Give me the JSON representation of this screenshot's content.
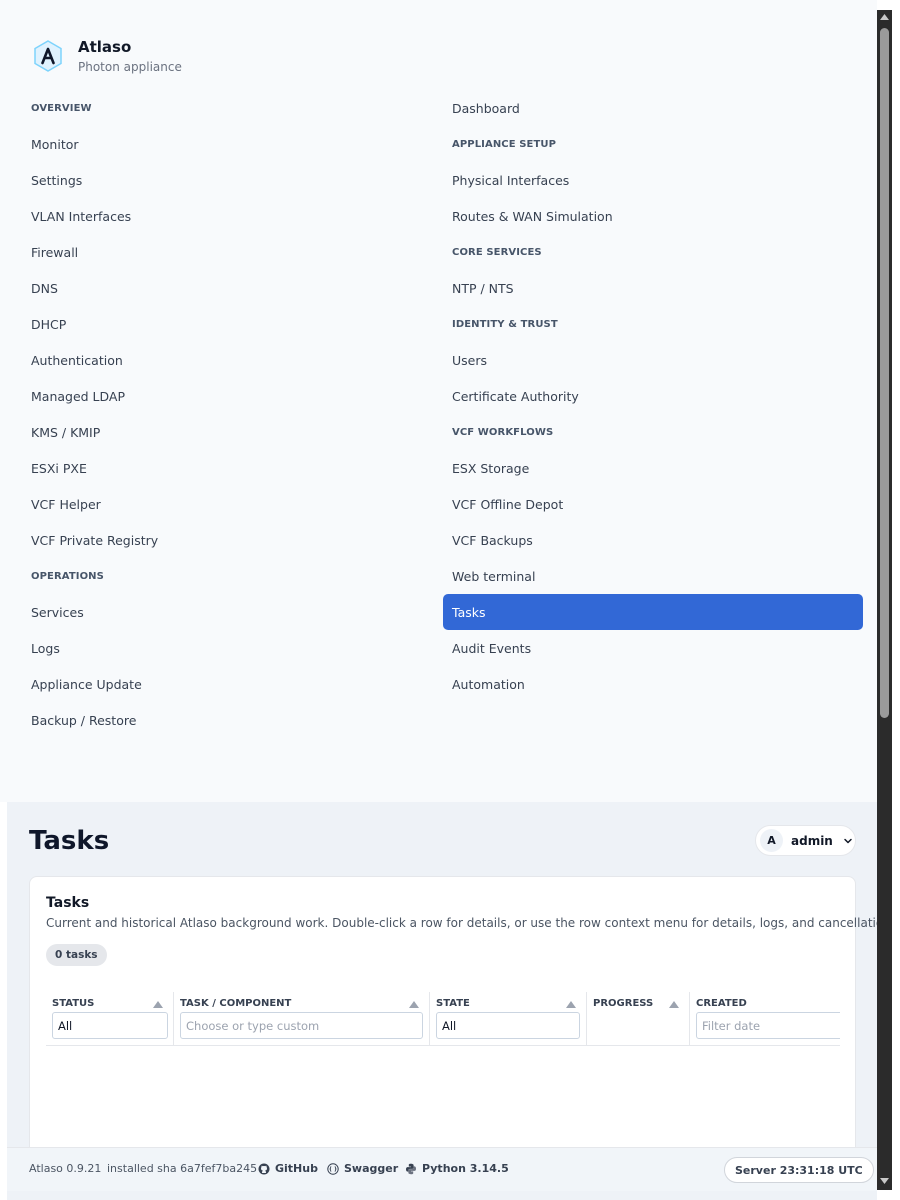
{
  "brand": {
    "name": "Atlaso",
    "subtitle": "Photon appliance"
  },
  "nav": {
    "left": [
      {
        "label": "OVERVIEW",
        "type": "section"
      },
      {
        "label": "Monitor",
        "type": "item"
      },
      {
        "label": "Settings",
        "type": "item"
      },
      {
        "label": "VLAN Interfaces",
        "type": "item"
      },
      {
        "label": "Firewall",
        "type": "item"
      },
      {
        "label": "DNS",
        "type": "item"
      },
      {
        "label": "DHCP",
        "type": "item"
      },
      {
        "label": "Authentication",
        "type": "item"
      },
      {
        "label": "Managed LDAP",
        "type": "item"
      },
      {
        "label": "KMS / KMIP",
        "type": "item"
      },
      {
        "label": "ESXi PXE",
        "type": "item"
      },
      {
        "label": "VCF Helper",
        "type": "item"
      },
      {
        "label": "VCF Private Registry",
        "type": "item"
      },
      {
        "label": "OPERATIONS",
        "type": "section"
      },
      {
        "label": "Services",
        "type": "item"
      },
      {
        "label": "Logs",
        "type": "item"
      },
      {
        "label": "Appliance Update",
        "type": "item"
      },
      {
        "label": "Backup / Restore",
        "type": "item"
      }
    ],
    "right": [
      {
        "label": "Dashboard",
        "type": "item"
      },
      {
        "label": "APPLIANCE SETUP",
        "type": "section"
      },
      {
        "label": "Physical Interfaces",
        "type": "item"
      },
      {
        "label": "Routes & WAN Simulation",
        "type": "item"
      },
      {
        "label": "CORE SERVICES",
        "type": "section"
      },
      {
        "label": "NTP / NTS",
        "type": "item"
      },
      {
        "label": "IDENTITY & TRUST",
        "type": "section"
      },
      {
        "label": "Users",
        "type": "item"
      },
      {
        "label": "Certificate Authority",
        "type": "item"
      },
      {
        "label": "VCF WORKFLOWS",
        "type": "section"
      },
      {
        "label": "ESX Storage",
        "type": "item"
      },
      {
        "label": "VCF Offline Depot",
        "type": "item"
      },
      {
        "label": "VCF Backups",
        "type": "item"
      },
      {
        "label": "Web terminal",
        "type": "item"
      },
      {
        "label": "Tasks",
        "type": "item",
        "active": true
      },
      {
        "label": "Audit Events",
        "type": "item"
      },
      {
        "label": "Automation",
        "type": "item"
      }
    ]
  },
  "page": {
    "title": "Tasks"
  },
  "user": {
    "initial": "A",
    "name": "admin"
  },
  "card": {
    "title": "Tasks",
    "description": "Current and historical Atlaso background work. Double-click a row for details, or use the row context menu for details, logs, and cancellation.",
    "count": "0 tasks"
  },
  "grid": {
    "columns": [
      {
        "header": "STATUS",
        "filter_value": "All",
        "filter_placeholder": ""
      },
      {
        "header": "TASK / COMPONENT",
        "filter_value": "",
        "filter_placeholder": "Choose or type custom"
      },
      {
        "header": "STATE",
        "filter_value": "All",
        "filter_placeholder": ""
      },
      {
        "header": "PROGRESS",
        "filter_value": "",
        "filter_placeholder": ""
      },
      {
        "header": "CREATED",
        "filter_value": "",
        "filter_placeholder": "Filter date"
      }
    ]
  },
  "footer": {
    "version": "Atlaso 0.9.21",
    "sha": "installed sha 6a7fef7ba245",
    "github": "GitHub",
    "swagger": "Swagger",
    "python": "Python 3.14.5",
    "server_time": "Server 23:31:18 UTC"
  },
  "colors": {
    "accent": "#3268d6",
    "nav_bg": "#f8fafc",
    "main_bg": "#eef2f7"
  }
}
